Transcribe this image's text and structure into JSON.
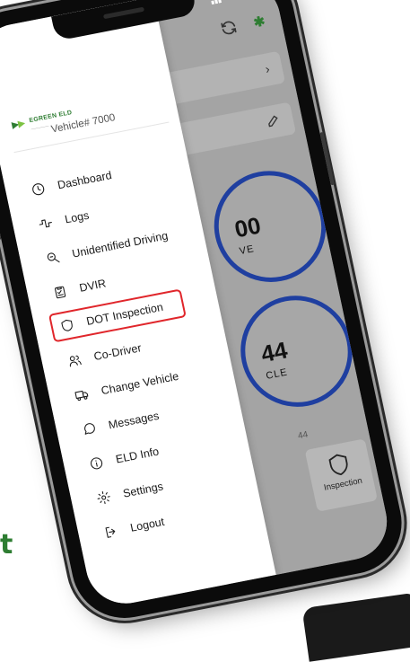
{
  "background": {
    "partial_text": "t"
  },
  "status_bar": {
    "icons": [
      "signal-icon",
      "wifi-icon",
      "battery-icon"
    ]
  },
  "drawer": {
    "brand": {
      "name": "EGREEN ELD",
      "tagline": "—————"
    },
    "vehicle_title": "Vehicle# 7000",
    "items": [
      {
        "label": "Dashboard",
        "icon": "clock-icon"
      },
      {
        "label": "Logs",
        "icon": "logs-icon"
      },
      {
        "label": "Unidentified Driving",
        "icon": "magnifier-icon"
      },
      {
        "label": "DVIR",
        "icon": "clipboard-icon"
      },
      {
        "label": "DOT Inspection",
        "icon": "shield-icon",
        "highlighted": true
      },
      {
        "label": "Co-Driver",
        "icon": "users-icon"
      },
      {
        "label": "Change Vehicle",
        "icon": "truck-icon"
      },
      {
        "label": "Messages",
        "icon": "chat-icon"
      },
      {
        "label": "ELD Info",
        "icon": "info-icon"
      },
      {
        "label": "Settings",
        "icon": "gear-icon"
      },
      {
        "label": "Logout",
        "icon": "logout-icon"
      }
    ]
  },
  "app": {
    "circle_1": {
      "value": "00",
      "label": "VE"
    },
    "circle_2": {
      "value": "44",
      "label": "CLE"
    },
    "faint_text": "44",
    "inspection_tab_label": "Inspection"
  },
  "colors": {
    "brand_green": "#2e7d32",
    "highlight_red": "#e0262b",
    "gauge_blue": "#1f3fa0"
  }
}
